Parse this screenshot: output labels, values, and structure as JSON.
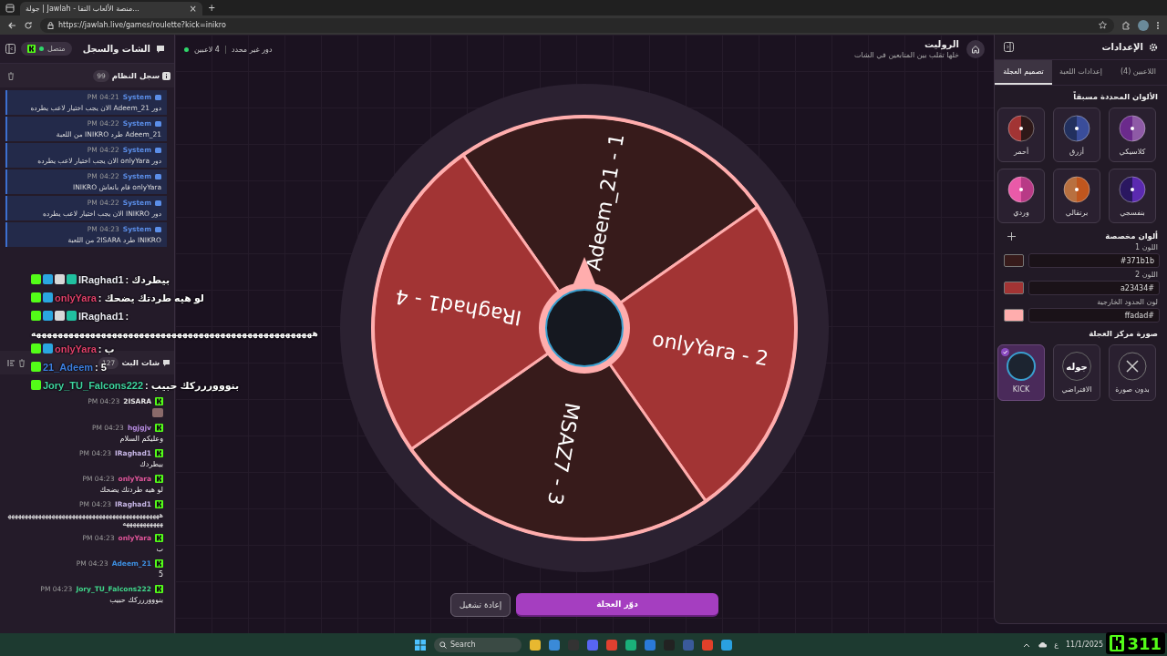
{
  "browser": {
    "tab_title": "جولة | Jawlah - منصة الألعاب التفا...",
    "tab_close": "×",
    "new_tab": "+",
    "url": "https://jawlah.live/games/roulette?kick=inikro"
  },
  "chat_panel": {
    "title": "الشات والسجل",
    "connection": "متصل",
    "connected": true,
    "log": {
      "title": "سجل النظام",
      "count": "99",
      "entries": [
        {
          "sender": "System",
          "time": "04:21 PM",
          "text": "دور Adeem_21 الان يجب اختيار لاعب يطرده"
        },
        {
          "sender": "System",
          "time": "04:22 PM",
          "text": "Adeem_21 طرد INIKRO من اللعبة"
        },
        {
          "sender": "System",
          "time": "04:22 PM",
          "text": "دور onlyYara الان يجب اختيار لاعب يطرده"
        },
        {
          "sender": "System",
          "time": "04:22 PM",
          "text": "onlyYara قام بانعاش INIKRO"
        },
        {
          "sender": "System",
          "time": "04:22 PM",
          "text": "دور INIKRO الان يجب اختيار لاعب يطرده"
        },
        {
          "sender": "System",
          "time": "04:23 PM",
          "text": "INIKRO طرد 2ISARA من اللعبة"
        }
      ]
    },
    "chat": {
      "title": "شات البث",
      "count": "127",
      "messages": [
        {
          "user": "2ISARA",
          "color": "#e6e6e6",
          "time": "04:23 PM",
          "kind": "sticker"
        },
        {
          "user": "hgjgjv",
          "color": "#b58be0",
          "time": "04:23 PM",
          "kind": "text",
          "text": "وعليكم السلام"
        },
        {
          "user": "IRaghad1",
          "color": "#c9b8e8",
          "time": "04:23 PM",
          "kind": "text",
          "text": "بيطردك"
        },
        {
          "user": "onlyYara",
          "color": "#e0559a",
          "time": "04:23 PM",
          "kind": "text",
          "text": "لو هيه طردتك يضحك"
        },
        {
          "user": "IRaghad1",
          "color": "#c9b8e8",
          "time": "04:23 PM",
          "kind": "text",
          "text": "هههههههههههههههههههههههههههههههههههههههههههههههههههههههههه"
        },
        {
          "user": "onlyYara",
          "color": "#e0559a",
          "time": "04:23 PM",
          "kind": "text",
          "text": "ب"
        },
        {
          "user": "Adeem_21",
          "color": "#3d8fe0",
          "time": "04:23 PM",
          "kind": "text",
          "text": "5"
        },
        {
          "user": "Jory_TU_Falcons222",
          "color": "#3fd68a",
          "time": "04:23 PM",
          "kind": "text",
          "text": "بنوووررركك حبيب"
        }
      ]
    }
  },
  "game": {
    "title": "الروليت",
    "subtitle": "خلها تقلب بين المتابعين في الشات",
    "players": "4 لاعبين",
    "turn": "دور غير محدد",
    "wheel": {
      "segments": [
        {
          "label": "Adeem_21 - 1",
          "color": "#371b1b"
        },
        {
          "label": "onlyYara - 2",
          "color": "#a23434"
        },
        {
          "label": "MSAZ7 - 3",
          "color": "#371b1b"
        },
        {
          "label": "IRaghad1 - 4",
          "color": "#a23434"
        }
      ]
    },
    "buttons": [
      {
        "label": "دوّر العجلة",
        "kind": "primary"
      },
      {
        "label": "إعادة تشغيل",
        "kind": "secondary"
      }
    ]
  },
  "settings": {
    "title": "الإعدادات",
    "tabs": [
      {
        "label": "اللاعبين (4)",
        "selected": false
      },
      {
        "label": "إعدادات اللعبة",
        "selected": false
      },
      {
        "label": "تصميم العجلة",
        "selected": true
      }
    ],
    "presets_title": "الألوان المحددة مسبقاً",
    "presets": [
      {
        "label": "كلاسيكي",
        "halves": [
          {
            "color": "#6b2a8c"
          },
          {
            "color": "#8e5aa6"
          }
        ]
      },
      {
        "label": "أزرق",
        "halves": [
          {
            "color": "#22305e"
          },
          {
            "color": "#3a4d9a"
          }
        ]
      },
      {
        "label": "أحمر",
        "halves": [
          {
            "color": "#a23434"
          },
          {
            "color": "#2e1818"
          }
        ]
      },
      {
        "label": "بنفسجي",
        "halves": [
          {
            "color": "#2a1760"
          },
          {
            "color": "#5b2ab0"
          }
        ]
      },
      {
        "label": "برتقالي",
        "halves": [
          {
            "color": "#b87040"
          },
          {
            "color": "#c0561e"
          }
        ]
      },
      {
        "label": "وردي",
        "halves": [
          {
            "color": "#e95aa8"
          },
          {
            "color": "#b83a86"
          }
        ]
      }
    ],
    "custom_title": "ألوان مخصصة",
    "custom_colors": [
      {
        "label": "اللون 1",
        "value": "#371b1b"
      },
      {
        "label": "اللون 2",
        "value": "#a23434"
      },
      {
        "label": "لون الحدود الخارجية",
        "value": "#ffadad"
      }
    ],
    "center_title": "صورة مركز العجلة",
    "center_images": [
      {
        "label": "بدون صورة",
        "kind": "none",
        "selected": false
      },
      {
        "label": "الافتراضي",
        "kind": "logo",
        "logo": "جوله",
        "selected": false
      },
      {
        "label": "KICK",
        "kind": "picture",
        "selected": true
      }
    ]
  },
  "overlay": {
    "lines": [
      {
        "user": "IRaghad1",
        "color": "#e8e8f0",
        "text": ": بيطردك",
        "kind": "inline",
        "badges": [
          {
            "color": "#53fc18"
          },
          {
            "color": "#2aa6e0"
          },
          {
            "color": "#d8d8d8"
          },
          {
            "color": "#20c0a0"
          }
        ]
      },
      {
        "user": "onlyYara",
        "color": "#e0406a",
        "text": ": لو هيه طردتك يضحك",
        "kind": "inline",
        "badges": [
          {
            "color": "#53fc18"
          },
          {
            "color": "#2aa6e0"
          }
        ]
      },
      {
        "user": "IRaghad1",
        "color": "#e8e8f0",
        "sep": ":",
        "text": "ههههههههههههههههههههههههههههههههههههههههههههههههههههه",
        "kind": "wrapped",
        "badges": [
          {
            "color": "#53fc18"
          },
          {
            "color": "#2aa6e0"
          },
          {
            "color": "#d8d8d8"
          },
          {
            "color": "#20c0a0"
          }
        ]
      },
      {
        "user": "onlyYara",
        "color": "#e0406a",
        "text": ": ب",
        "kind": "inline",
        "badges": [
          {
            "color": "#53fc18"
          },
          {
            "color": "#2aa6e0"
          }
        ]
      },
      {
        "user": "21_Adeem",
        "color": "#3d7fe0",
        "text": ": 5",
        "kind": "inline",
        "badges": [
          {
            "color": "#53fc18"
          }
        ]
      },
      {
        "user": "Jory_TU_Falcons222",
        "color": "#3fd6a0",
        "text": ": بنوووررركك حبيب",
        "kind": "inline",
        "badges": [
          {
            "color": "#53fc18"
          }
        ]
      }
    ],
    "counter": "311"
  },
  "taskbar": {
    "search": "Search",
    "lang": "ع",
    "date": "11/1/2025"
  }
}
